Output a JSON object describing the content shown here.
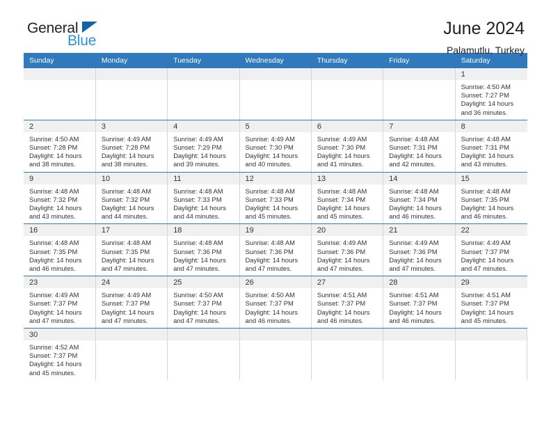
{
  "brand": {
    "name_part1": "General",
    "name_part2": "Blue",
    "triangle_icon": "triangle-icon",
    "color_dark": "#231f20",
    "color_blue": "#2a93d5",
    "color_triangle": "#1263ab"
  },
  "header": {
    "title": "June 2024",
    "subtitle": "Palamutlu, Turkey"
  },
  "theme": {
    "header_bg": "#3079bd",
    "header_text": "#ffffff",
    "daynum_bg": "#f0f0f0",
    "row_divider": "#3079bd"
  },
  "weekday_headers": [
    "Sunday",
    "Monday",
    "Tuesday",
    "Wednesday",
    "Thursday",
    "Friday",
    "Saturday"
  ],
  "weeks": [
    [
      {
        "day": "",
        "blank": true
      },
      {
        "day": "",
        "blank": true
      },
      {
        "day": "",
        "blank": true
      },
      {
        "day": "",
        "blank": true
      },
      {
        "day": "",
        "blank": true
      },
      {
        "day": "",
        "blank": true
      },
      {
        "day": "1",
        "sunrise": "Sunrise: 4:50 AM",
        "sunset": "Sunset: 7:27 PM",
        "daylight_line1": "Daylight: 14 hours",
        "daylight_line2": "and 36 minutes."
      }
    ],
    [
      {
        "day": "2",
        "sunrise": "Sunrise: 4:50 AM",
        "sunset": "Sunset: 7:28 PM",
        "daylight_line1": "Daylight: 14 hours",
        "daylight_line2": "and 38 minutes."
      },
      {
        "day": "3",
        "sunrise": "Sunrise: 4:49 AM",
        "sunset": "Sunset: 7:28 PM",
        "daylight_line1": "Daylight: 14 hours",
        "daylight_line2": "and 38 minutes."
      },
      {
        "day": "4",
        "sunrise": "Sunrise: 4:49 AM",
        "sunset": "Sunset: 7:29 PM",
        "daylight_line1": "Daylight: 14 hours",
        "daylight_line2": "and 39 minutes."
      },
      {
        "day": "5",
        "sunrise": "Sunrise: 4:49 AM",
        "sunset": "Sunset: 7:30 PM",
        "daylight_line1": "Daylight: 14 hours",
        "daylight_line2": "and 40 minutes."
      },
      {
        "day": "6",
        "sunrise": "Sunrise: 4:49 AM",
        "sunset": "Sunset: 7:30 PM",
        "daylight_line1": "Daylight: 14 hours",
        "daylight_line2": "and 41 minutes."
      },
      {
        "day": "7",
        "sunrise": "Sunrise: 4:48 AM",
        "sunset": "Sunset: 7:31 PM",
        "daylight_line1": "Daylight: 14 hours",
        "daylight_line2": "and 42 minutes."
      },
      {
        "day": "8",
        "sunrise": "Sunrise: 4:48 AM",
        "sunset": "Sunset: 7:31 PM",
        "daylight_line1": "Daylight: 14 hours",
        "daylight_line2": "and 43 minutes."
      }
    ],
    [
      {
        "day": "9",
        "sunrise": "Sunrise: 4:48 AM",
        "sunset": "Sunset: 7:32 PM",
        "daylight_line1": "Daylight: 14 hours",
        "daylight_line2": "and 43 minutes."
      },
      {
        "day": "10",
        "sunrise": "Sunrise: 4:48 AM",
        "sunset": "Sunset: 7:32 PM",
        "daylight_line1": "Daylight: 14 hours",
        "daylight_line2": "and 44 minutes."
      },
      {
        "day": "11",
        "sunrise": "Sunrise: 4:48 AM",
        "sunset": "Sunset: 7:33 PM",
        "daylight_line1": "Daylight: 14 hours",
        "daylight_line2": "and 44 minutes."
      },
      {
        "day": "12",
        "sunrise": "Sunrise: 4:48 AM",
        "sunset": "Sunset: 7:33 PM",
        "daylight_line1": "Daylight: 14 hours",
        "daylight_line2": "and 45 minutes."
      },
      {
        "day": "13",
        "sunrise": "Sunrise: 4:48 AM",
        "sunset": "Sunset: 7:34 PM",
        "daylight_line1": "Daylight: 14 hours",
        "daylight_line2": "and 45 minutes."
      },
      {
        "day": "14",
        "sunrise": "Sunrise: 4:48 AM",
        "sunset": "Sunset: 7:34 PM",
        "daylight_line1": "Daylight: 14 hours",
        "daylight_line2": "and 46 minutes."
      },
      {
        "day": "15",
        "sunrise": "Sunrise: 4:48 AM",
        "sunset": "Sunset: 7:35 PM",
        "daylight_line1": "Daylight: 14 hours",
        "daylight_line2": "and 46 minutes."
      }
    ],
    [
      {
        "day": "16",
        "sunrise": "Sunrise: 4:48 AM",
        "sunset": "Sunset: 7:35 PM",
        "daylight_line1": "Daylight: 14 hours",
        "daylight_line2": "and 46 minutes."
      },
      {
        "day": "17",
        "sunrise": "Sunrise: 4:48 AM",
        "sunset": "Sunset: 7:35 PM",
        "daylight_line1": "Daylight: 14 hours",
        "daylight_line2": "and 47 minutes."
      },
      {
        "day": "18",
        "sunrise": "Sunrise: 4:48 AM",
        "sunset": "Sunset: 7:36 PM",
        "daylight_line1": "Daylight: 14 hours",
        "daylight_line2": "and 47 minutes."
      },
      {
        "day": "19",
        "sunrise": "Sunrise: 4:48 AM",
        "sunset": "Sunset: 7:36 PM",
        "daylight_line1": "Daylight: 14 hours",
        "daylight_line2": "and 47 minutes."
      },
      {
        "day": "20",
        "sunrise": "Sunrise: 4:49 AM",
        "sunset": "Sunset: 7:36 PM",
        "daylight_line1": "Daylight: 14 hours",
        "daylight_line2": "and 47 minutes."
      },
      {
        "day": "21",
        "sunrise": "Sunrise: 4:49 AM",
        "sunset": "Sunset: 7:36 PM",
        "daylight_line1": "Daylight: 14 hours",
        "daylight_line2": "and 47 minutes."
      },
      {
        "day": "22",
        "sunrise": "Sunrise: 4:49 AM",
        "sunset": "Sunset: 7:37 PM",
        "daylight_line1": "Daylight: 14 hours",
        "daylight_line2": "and 47 minutes."
      }
    ],
    [
      {
        "day": "23",
        "sunrise": "Sunrise: 4:49 AM",
        "sunset": "Sunset: 7:37 PM",
        "daylight_line1": "Daylight: 14 hours",
        "daylight_line2": "and 47 minutes."
      },
      {
        "day": "24",
        "sunrise": "Sunrise: 4:49 AM",
        "sunset": "Sunset: 7:37 PM",
        "daylight_line1": "Daylight: 14 hours",
        "daylight_line2": "and 47 minutes."
      },
      {
        "day": "25",
        "sunrise": "Sunrise: 4:50 AM",
        "sunset": "Sunset: 7:37 PM",
        "daylight_line1": "Daylight: 14 hours",
        "daylight_line2": "and 47 minutes."
      },
      {
        "day": "26",
        "sunrise": "Sunrise: 4:50 AM",
        "sunset": "Sunset: 7:37 PM",
        "daylight_line1": "Daylight: 14 hours",
        "daylight_line2": "and 46 minutes."
      },
      {
        "day": "27",
        "sunrise": "Sunrise: 4:51 AM",
        "sunset": "Sunset: 7:37 PM",
        "daylight_line1": "Daylight: 14 hours",
        "daylight_line2": "and 46 minutes."
      },
      {
        "day": "28",
        "sunrise": "Sunrise: 4:51 AM",
        "sunset": "Sunset: 7:37 PM",
        "daylight_line1": "Daylight: 14 hours",
        "daylight_line2": "and 46 minutes."
      },
      {
        "day": "29",
        "sunrise": "Sunrise: 4:51 AM",
        "sunset": "Sunset: 7:37 PM",
        "daylight_line1": "Daylight: 14 hours",
        "daylight_line2": "and 45 minutes."
      }
    ],
    [
      {
        "day": "30",
        "sunrise": "Sunrise: 4:52 AM",
        "sunset": "Sunset: 7:37 PM",
        "daylight_line1": "Daylight: 14 hours",
        "daylight_line2": "and 45 minutes."
      },
      {
        "day": "",
        "blank": true
      },
      {
        "day": "",
        "blank": true
      },
      {
        "day": "",
        "blank": true
      },
      {
        "day": "",
        "blank": true
      },
      {
        "day": "",
        "blank": true
      },
      {
        "day": "",
        "blank": true
      }
    ]
  ]
}
